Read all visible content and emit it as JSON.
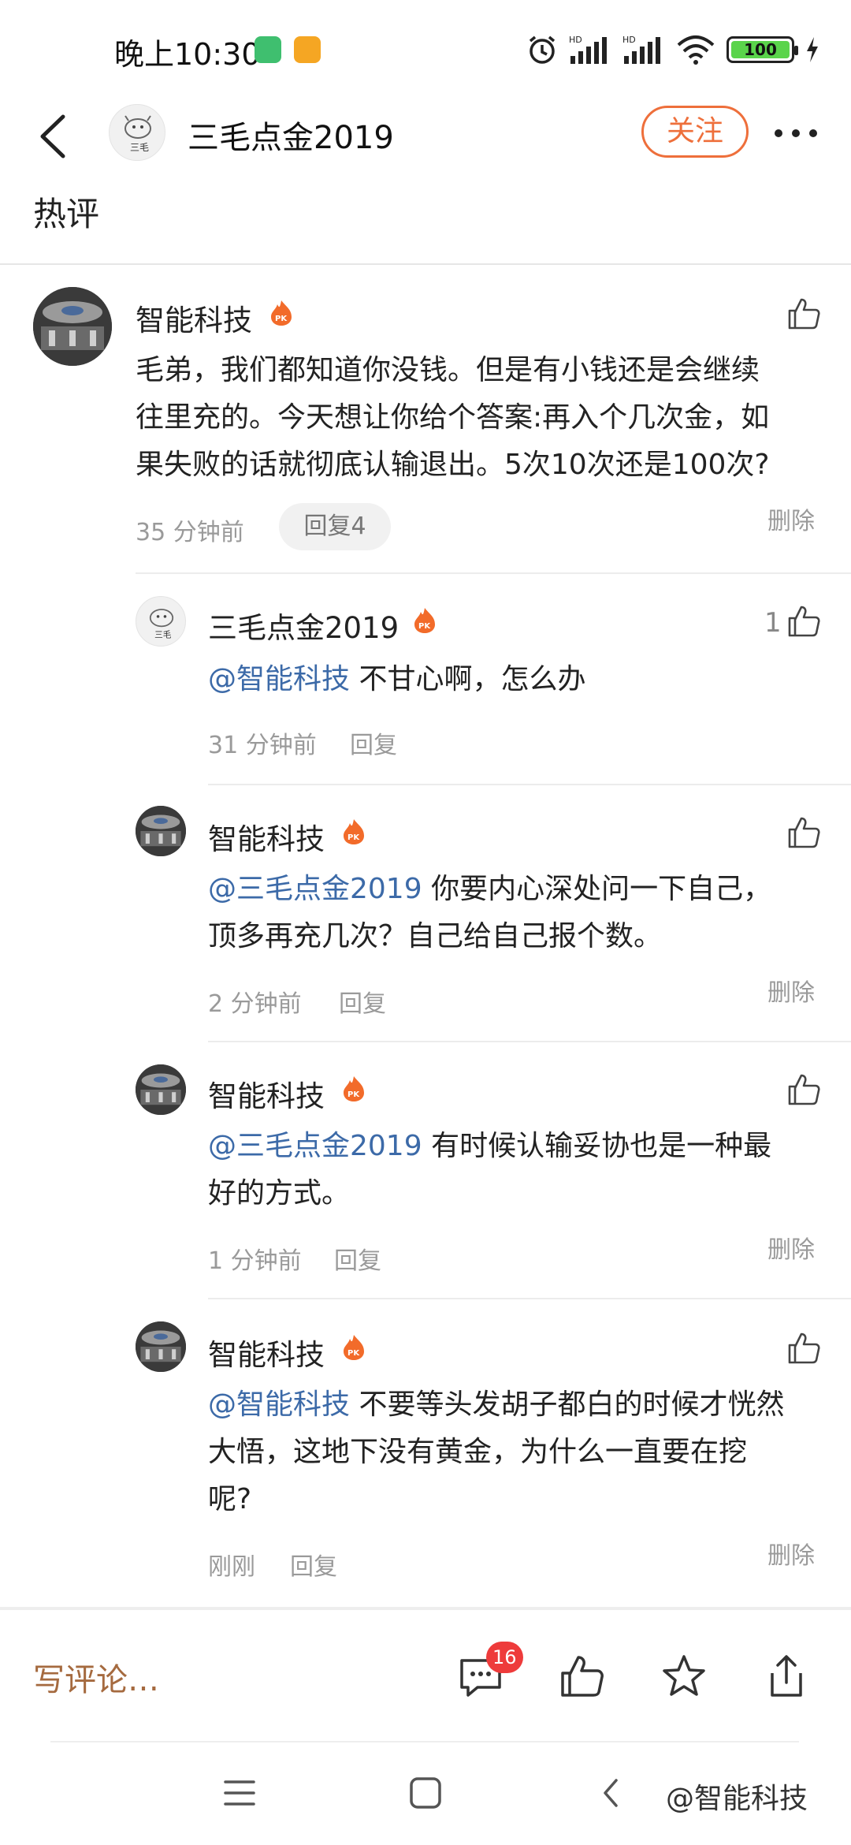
{
  "status_bar": {
    "time": "晚上10:30",
    "battery": "100",
    "app_icon_colors": [
      "#3fbf6f",
      "#f5a623"
    ]
  },
  "header": {
    "account_name": "三毛点金2019",
    "follow_label": "关注"
  },
  "section_title": "热评",
  "comments": [
    {
      "name": "智能科技",
      "text_lines": [
        "毛弟，我们都知道你没钱。但是有小钱还是会继续",
        "往里充的。今天想让你给个答案:再入个几次金，如",
        "果失败的话就彻底认输退出。5次10次还是100次?"
      ],
      "time": "35 分钟前",
      "reply_label": "回复4",
      "delete_label": "删除"
    }
  ],
  "replies": [
    {
      "name": "三毛点金2019",
      "mention": "@智能科技",
      "text_lines": [
        " 不甘心啊，怎么办"
      ],
      "time": "31 分钟前",
      "reply_label": "回复",
      "like_count": "1"
    },
    {
      "name": "智能科技",
      "mention": "@三毛点金2019",
      "text_lines": [
        " 你要内心深处问一下自己，",
        "顶多再充几次？自己给自己报个数。"
      ],
      "time": "2 分钟前",
      "reply_label": "回复",
      "delete_label": "删除"
    },
    {
      "name": "智能科技",
      "mention": "@三毛点金2019",
      "text_lines": [
        " 有时候认输妥协也是一种最",
        "好的方式。"
      ],
      "time": "1 分钟前",
      "reply_label": "回复",
      "delete_label": "删除"
    },
    {
      "name": "智能科技",
      "mention": "@智能科技",
      "text_lines": [
        " 不要等头发胡子都白的时候才恍然",
        "大悟，这地下没有黄金，为什么一直要在挖",
        "呢?"
      ],
      "time": "刚刚",
      "reply_label": "回复",
      "delete_label": "删除"
    }
  ],
  "bottom_bar": {
    "write_placeholder": "写评论…",
    "comment_count": "16",
    "icons": [
      "comment-icon",
      "like-icon",
      "star-icon",
      "share-icon"
    ]
  },
  "avatar_badge_text": "三毛",
  "watermark": "@智能科技",
  "colors": {
    "accent": "#ee6f3b",
    "mention": "#3c6aa8",
    "badge": "#ee3b3b",
    "write_comment": "#a56a3f"
  }
}
